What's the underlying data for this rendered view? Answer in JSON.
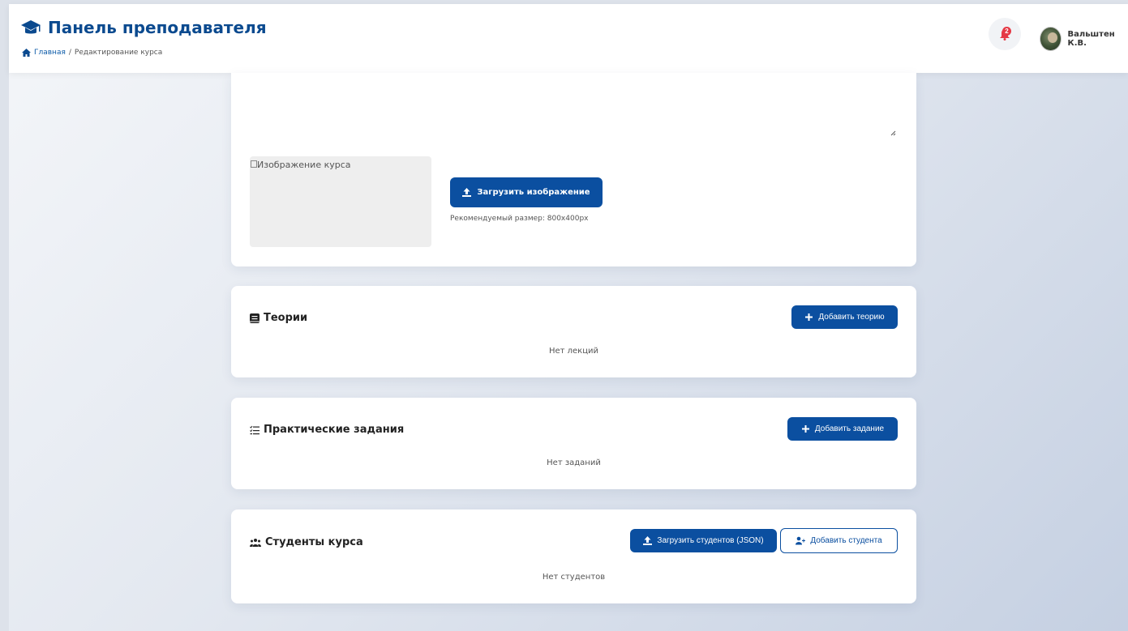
{
  "header": {
    "title": "Панель преподавателя",
    "breadcrumb": {
      "home": "Главная",
      "separator": "/",
      "current": "Редактирование курса"
    },
    "notifications": {
      "count": "2",
      "icon": "bell-icon"
    },
    "user": {
      "name": "Вальштен К.В.",
      "avatar": "avatar"
    }
  },
  "image_section": {
    "image_alt": "Изображение курса",
    "upload_button": "Загрузить изображение",
    "hint": "Рекомендуемый размер: 800x400px"
  },
  "theories": {
    "title": "Теории",
    "add_button": "Добавить теорию",
    "empty": "Нет лекций"
  },
  "assignments": {
    "title": "Практические задания",
    "add_button": "Добавить задание",
    "empty": "Нет заданий"
  },
  "students": {
    "title": "Студенты курса",
    "upload_button": "Загрузить студентов (JSON)",
    "add_button": "Добавить студента",
    "empty": "Нет студентов"
  },
  "colors": {
    "primary": "#0b4fa0",
    "brand_text": "#0b4a8f",
    "badge": "#e53945"
  }
}
